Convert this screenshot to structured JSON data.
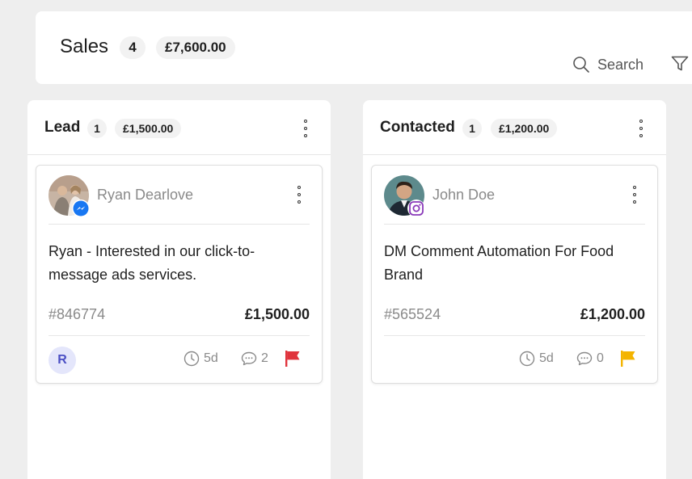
{
  "board": {
    "title": "Sales",
    "count": "4",
    "total": "£7,600.00"
  },
  "toolbar": {
    "search_label": "Search"
  },
  "columns": [
    {
      "title": "Lead",
      "count": "1",
      "total": "£1,500.00",
      "card": {
        "name": "Ryan Dearlove",
        "channel": "messenger-icon",
        "description": "Ryan - Interested in our click-to-message ads services.",
        "id": "#846774",
        "amount": "£1,500.00",
        "assignee": "R",
        "age": "5d",
        "comments": "2",
        "flag_color": "#e0343d"
      }
    },
    {
      "title": "Contacted",
      "count": "1",
      "total": "£1,200.00",
      "card": {
        "name": "John Doe",
        "channel": "instagram-icon",
        "description": "DM Comment Automation For Food Brand",
        "id": "#565524",
        "amount": "£1,200.00",
        "age": "5d",
        "comments": "0",
        "flag_color": "#f4b400"
      }
    }
  ],
  "colors": {
    "accent": "#4b4fc4",
    "messenger": "#1877f2",
    "instagram": "#8a3ab9"
  }
}
